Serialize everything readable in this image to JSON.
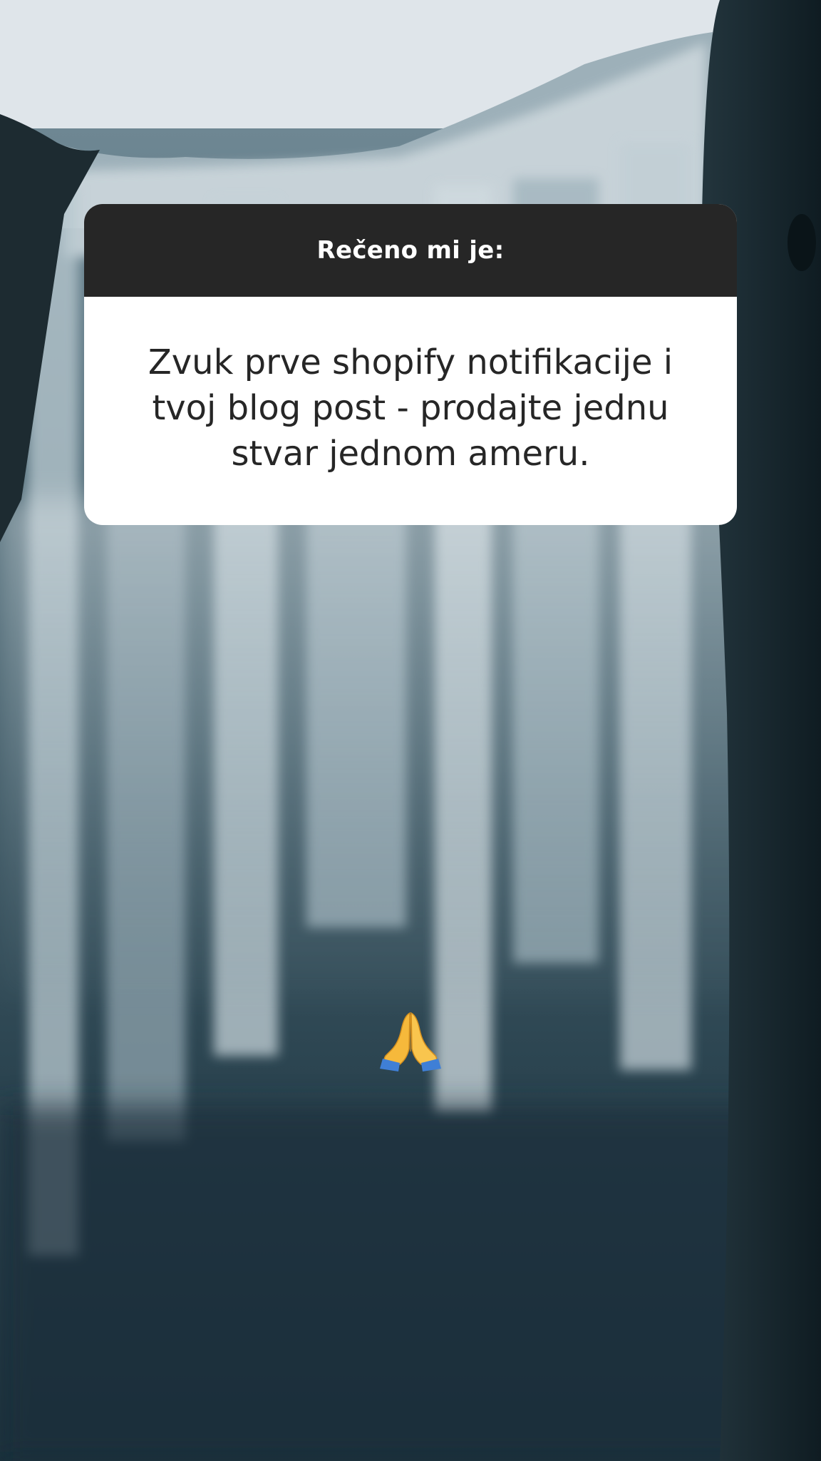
{
  "question_card": {
    "title": "Rečeno mi je:",
    "answer": "Zvuk prve shopify notifikacije i tvoj blog post - prodajte jednu stvar jednom ameru."
  },
  "sticker": {
    "icon": "folded-hands-icon",
    "glyph": "🙏"
  },
  "colors": {
    "card_header": "#262626",
    "card_body": "#ffffff",
    "sky": "#dfe5ea",
    "water_dark": "#1f3540",
    "cliff": "#17252c"
  }
}
